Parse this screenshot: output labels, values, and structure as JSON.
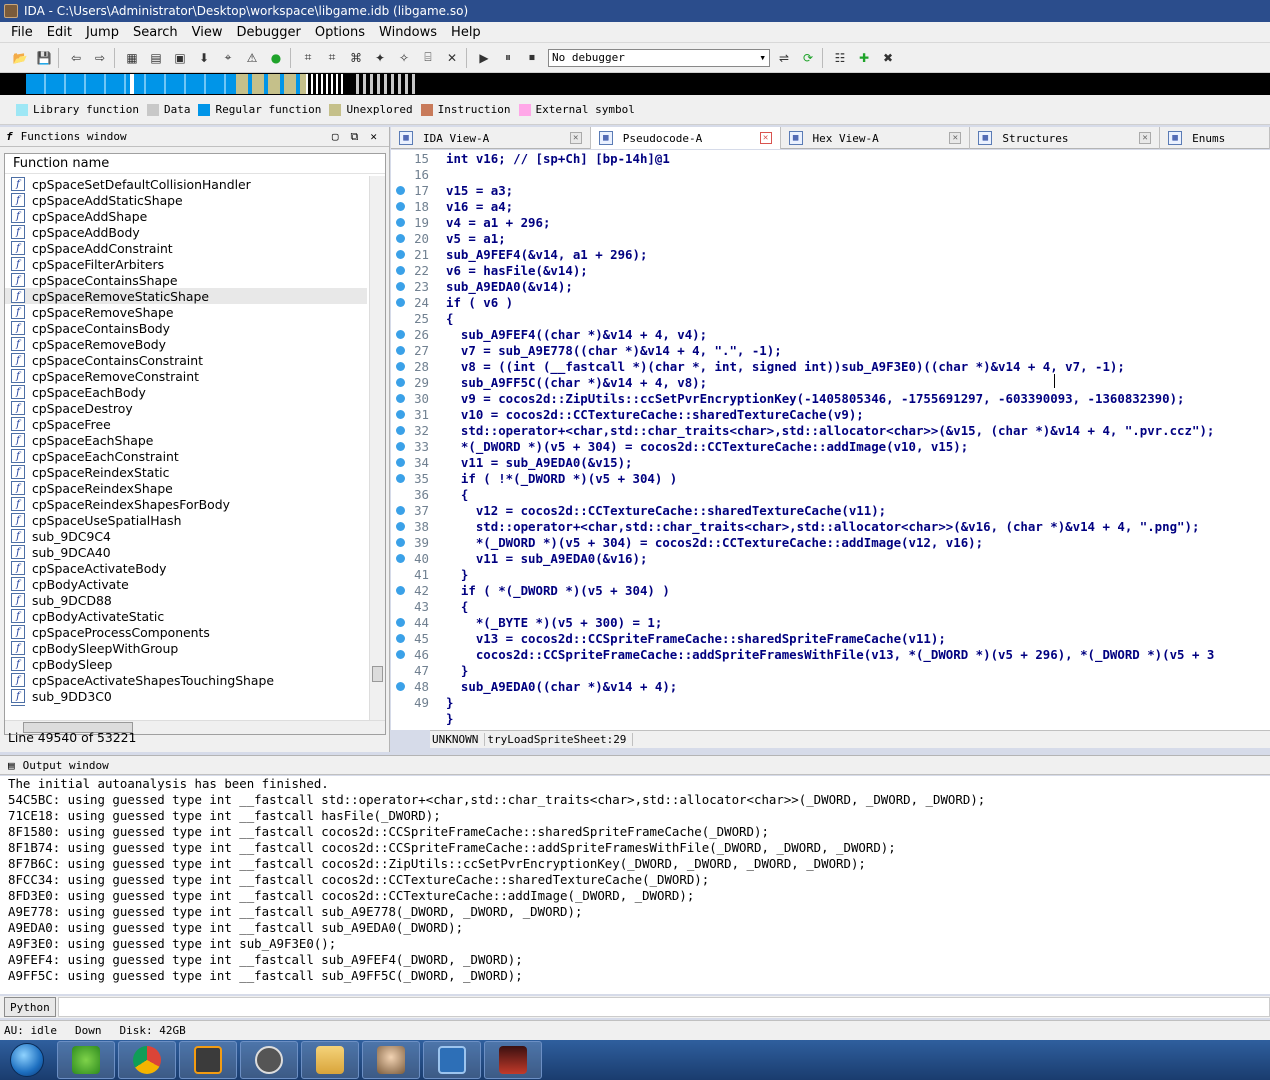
{
  "window": {
    "title": "IDA - C:\\Users\\Administrator\\Desktop\\workspace\\libgame.idb (libgame.so)"
  },
  "menu": [
    "File",
    "Edit",
    "Jump",
    "Search",
    "View",
    "Debugger",
    "Options",
    "Windows",
    "Help"
  ],
  "toolbar": {
    "debugger_select": "No debugger"
  },
  "legend": [
    {
      "label": "Library function",
      "color": "#9ee7f5"
    },
    {
      "label": "Data",
      "color": "#c8c8c8"
    },
    {
      "label": "Regular function",
      "color": "#0095e8"
    },
    {
      "label": "Unexplored",
      "color": "#c5c08a"
    },
    {
      "label": "Instruction",
      "color": "#c87a5a"
    },
    {
      "label": "External symbol",
      "color": "#ffa7e8"
    }
  ],
  "functions": {
    "title": "Functions window",
    "column": "Function name",
    "items": [
      "cpSpaceSetDefaultCollisionHandler",
      "cpSpaceAddStaticShape",
      "cpSpaceAddShape",
      "cpSpaceAddBody",
      "cpSpaceAddConstraint",
      "cpSpaceFilterArbiters",
      "cpSpaceContainsShape",
      "cpSpaceRemoveStaticShape",
      "cpSpaceRemoveShape",
      "cpSpaceContainsBody",
      "cpSpaceRemoveBody",
      "cpSpaceContainsConstraint",
      "cpSpaceRemoveConstraint",
      "cpSpaceEachBody",
      "cpSpaceDestroy",
      "cpSpaceFree",
      "cpSpaceEachShape",
      "cpSpaceEachConstraint",
      "cpSpaceReindexStatic",
      "cpSpaceReindexShape",
      "cpSpaceReindexShapesForBody",
      "cpSpaceUseSpatialHash",
      "sub_9DC9C4",
      "sub_9DCA40",
      "cpSpaceActivateBody",
      "cpBodyActivate",
      "sub_9DCD88",
      "cpBodyActivateStatic",
      "cpSpaceProcessComponents",
      "cpBodySleepWithGroup",
      "cpBodySleep",
      "cpSpaceActivateShapesTouchingShape",
      "sub_9DD3C0",
      "sub_9DD400"
    ],
    "selected_index": 7,
    "status": "Line 49540 of 53221"
  },
  "tabs": [
    {
      "label": "IDA View-A",
      "icon": "graph-icon"
    },
    {
      "label": "Pseudocode-A",
      "icon": "pseudocode-icon"
    },
    {
      "label": "Hex View-A",
      "icon": "hex-icon"
    },
    {
      "label": "Structures",
      "icon": "struct-icon"
    },
    {
      "label": "Enums",
      "icon": "enum-icon"
    }
  ],
  "code": {
    "lines": [
      {
        "n": "15",
        "dot": false,
        "t": "int v16; // [sp+Ch] [bp-14h]@1"
      },
      {
        "n": "16",
        "dot": false,
        "t": ""
      },
      {
        "n": "17",
        "dot": true,
        "t": "v15 = a3;"
      },
      {
        "n": "18",
        "dot": true,
        "t": "v16 = a4;"
      },
      {
        "n": "19",
        "dot": true,
        "t": "v4 = a1 + 296;"
      },
      {
        "n": "20",
        "dot": true,
        "t": "v5 = a1;"
      },
      {
        "n": "21",
        "dot": true,
        "t": "sub_A9FEF4(&v14, a1 + 296);"
      },
      {
        "n": "22",
        "dot": true,
        "t": "v6 = hasFile(&v14);"
      },
      {
        "n": "23",
        "dot": true,
        "t": "sub_A9EDA0(&v14);"
      },
      {
        "n": "24",
        "dot": true,
        "t": "if ( v6 )"
      },
      {
        "n": "25",
        "dot": false,
        "t": "{"
      },
      {
        "n": "26",
        "dot": true,
        "t": "  sub_A9FEF4((char *)&v14 + 4, v4);"
      },
      {
        "n": "27",
        "dot": true,
        "t": "  v7 = sub_A9E778((char *)&v14 + 4, \".\", -1);"
      },
      {
        "n": "28",
        "dot": true,
        "t": "  v8 = ((int (__fastcall *)(char *, int, signed int))sub_A9F3E0)((char *)&v14 + 4, v7, -1);"
      },
      {
        "n": "29",
        "dot": true,
        "t": "  sub_A9FF5C((char *)&v14 + 4, v8);"
      },
      {
        "n": "30",
        "dot": true,
        "t": "  v9 = cocos2d::ZipUtils::ccSetPvrEncryptionKey(-1405805346, -1755691297, -603390093, -1360832390);"
      },
      {
        "n": "31",
        "dot": true,
        "t": "  v10 = cocos2d::CCTextureCache::sharedTextureCache(v9);"
      },
      {
        "n": "32",
        "dot": true,
        "t": "  std::operator+<char,std::char_traits<char>,std::allocator<char>>(&v15, (char *)&v14 + 4, \".pvr.ccz\");"
      },
      {
        "n": "33",
        "dot": true,
        "t": "  *(_DWORD *)(v5 + 304) = cocos2d::CCTextureCache::addImage(v10, v15);"
      },
      {
        "n": "34",
        "dot": true,
        "t": "  v11 = sub_A9EDA0(&v15);"
      },
      {
        "n": "35",
        "dot": true,
        "t": "  if ( !*(_DWORD *)(v5 + 304) )"
      },
      {
        "n": "36",
        "dot": false,
        "t": "  {"
      },
      {
        "n": "37",
        "dot": true,
        "t": "    v12 = cocos2d::CCTextureCache::sharedTextureCache(v11);"
      },
      {
        "n": "38",
        "dot": true,
        "t": "    std::operator+<char,std::char_traits<char>,std::allocator<char>>(&v16, (char *)&v14 + 4, \".png\");"
      },
      {
        "n": "39",
        "dot": true,
        "t": "    *(_DWORD *)(v5 + 304) = cocos2d::CCTextureCache::addImage(v12, v16);"
      },
      {
        "n": "40",
        "dot": true,
        "t": "    v11 = sub_A9EDA0(&v16);"
      },
      {
        "n": "41",
        "dot": false,
        "t": "  }"
      },
      {
        "n": "42",
        "dot": true,
        "t": "  if ( *(_DWORD *)(v5 + 304) )"
      },
      {
        "n": "43",
        "dot": false,
        "t": "  {"
      },
      {
        "n": "44",
        "dot": true,
        "t": "    *(_BYTE *)(v5 + 300) = 1;"
      },
      {
        "n": "45",
        "dot": true,
        "t": "    v13 = cocos2d::CCSpriteFrameCache::sharedSpriteFrameCache(v11);"
      },
      {
        "n": "46",
        "dot": true,
        "t": "    cocos2d::CCSpriteFrameCache::addSpriteFramesWithFile(v13, *(_DWORD *)(v5 + 296), *(_DWORD *)(v5 + 3"
      },
      {
        "n": "47",
        "dot": false,
        "t": "  }"
      },
      {
        "n": "48",
        "dot": true,
        "t": "  sub_A9EDA0((char *)&v14 + 4);"
      },
      {
        "n": "49",
        "dot": false,
        "t": "}"
      },
      {
        "n": "",
        "dot": false,
        "t": "}"
      }
    ],
    "status_type": "UNKNOWN",
    "status_loc": "tryLoadSpriteSheet:29"
  },
  "output": {
    "title": "Output window",
    "lines": [
      "The initial autoanalysis has been finished.",
      "54C5BC: using guessed type int __fastcall std::operator+<char,std::char_traits<char>,std::allocator<char>>(_DWORD, _DWORD, _DWORD);",
      "71CE18: using guessed type int __fastcall hasFile(_DWORD);",
      "8F1580: using guessed type int __fastcall cocos2d::CCSpriteFrameCache::sharedSpriteFrameCache(_DWORD);",
      "8F1B74: using guessed type int __fastcall cocos2d::CCSpriteFrameCache::addSpriteFramesWithFile(_DWORD, _DWORD, _DWORD);",
      "8F7B6C: using guessed type int __fastcall cocos2d::ZipUtils::ccSetPvrEncryptionKey(_DWORD, _DWORD, _DWORD, _DWORD);",
      "8FCC34: using guessed type int __fastcall cocos2d::CCTextureCache::sharedTextureCache(_DWORD);",
      "8FD3E0: using guessed type int __fastcall cocos2d::CCTextureCache::addImage(_DWORD, _DWORD);",
      "A9E778: using guessed type int __fastcall sub_A9E778(_DWORD, _DWORD, _DWORD);",
      "A9EDA0: using guessed type int __fastcall sub_A9EDA0(_DWORD);",
      "A9F3E0: using guessed type int sub_A9F3E0();",
      "A9FEF4: using guessed type int __fastcall sub_A9FEF4(_DWORD, _DWORD);",
      "A9FF5C: using guessed type int __fastcall sub_A9FF5C(_DWORD, _DWORD);"
    ]
  },
  "python_button": "Python",
  "status": {
    "au": "AU:  idle",
    "dir": "Down",
    "disk": "Disk: 42GB"
  }
}
